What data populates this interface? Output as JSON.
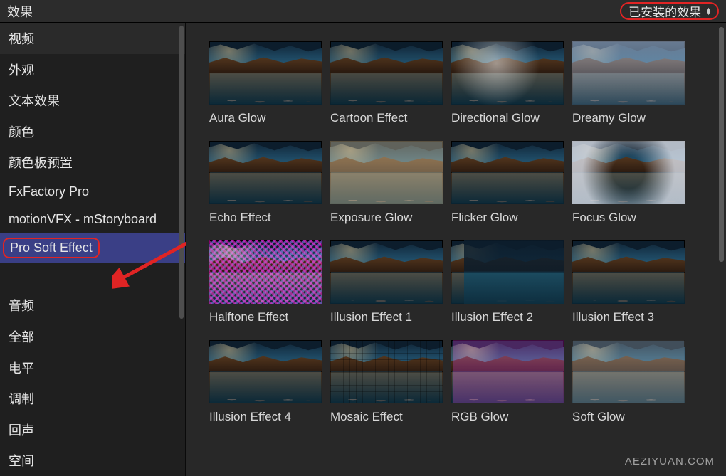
{
  "header": {
    "title": "效果",
    "dropdown_label": "已安装的效果"
  },
  "sidebar": {
    "groups": [
      {
        "kind": "group",
        "label": "视频"
      },
      {
        "kind": "item",
        "label": "外观"
      },
      {
        "kind": "item",
        "label": "文本效果"
      },
      {
        "kind": "item",
        "label": "颜色"
      },
      {
        "kind": "item",
        "label": "颜色板预置"
      },
      {
        "kind": "item",
        "label": "FxFactory Pro"
      },
      {
        "kind": "item",
        "label": "motionVFX - mStoryboard"
      },
      {
        "kind": "item",
        "label": "Pro Soft Effect",
        "selected": true,
        "highlighted": true
      },
      {
        "kind": "gap"
      },
      {
        "kind": "item",
        "label": "音频"
      },
      {
        "kind": "item",
        "label": "全部"
      },
      {
        "kind": "item",
        "label": "电平"
      },
      {
        "kind": "item",
        "label": "调制"
      },
      {
        "kind": "item",
        "label": "回声"
      },
      {
        "kind": "item",
        "label": "空间"
      }
    ]
  },
  "effects": [
    {
      "label": "Aura Glow",
      "overlay": ""
    },
    {
      "label": "Cartoon Effect",
      "overlay": "ov-cartoon"
    },
    {
      "label": "Directional Glow",
      "overlay": "ov-directional"
    },
    {
      "label": "Dreamy Glow",
      "overlay": "ov-dreamy"
    },
    {
      "label": "Echo Effect",
      "overlay": ""
    },
    {
      "label": "Exposure Glow",
      "overlay": "ov-exposure"
    },
    {
      "label": "Flicker Glow",
      "overlay": ""
    },
    {
      "label": "Focus Glow",
      "overlay": "ov-focus"
    },
    {
      "label": "Halftone Effect",
      "overlay": "ov-halftone"
    },
    {
      "label": "Illusion Effect 1",
      "overlay": ""
    },
    {
      "label": "Illusion Effect 2",
      "overlay": "ov-ill2"
    },
    {
      "label": "Illusion Effect 3",
      "overlay": ""
    },
    {
      "label": "Illusion Effect 4",
      "overlay": ""
    },
    {
      "label": "Mosaic Effect",
      "overlay": "ov-mosaic"
    },
    {
      "label": "RGB Glow",
      "overlay": "ov-rgb"
    },
    {
      "label": "Soft Glow",
      "overlay": "ov-soft"
    }
  ],
  "watermark": "AEZIYUAN.COM"
}
